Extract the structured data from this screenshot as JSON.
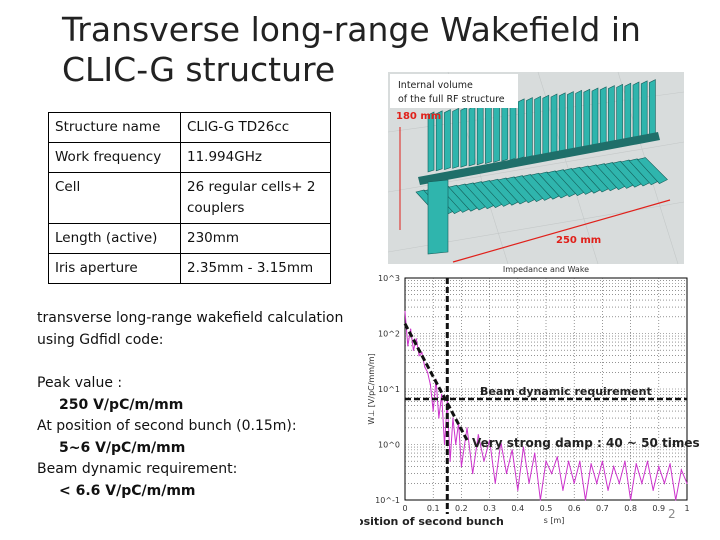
{
  "title": "Transverse long-range Wakefield in CLIC-G structure",
  "table": [
    {
      "key": "Structure name",
      "value": "CLIG-G TD26cc"
    },
    {
      "key": "Work frequency",
      "value": "11.994GHz"
    },
    {
      "key": "Cell",
      "value": "26 regular cells+ 2 couplers"
    },
    {
      "key": "Length (active)",
      "value": "230mm"
    },
    {
      "key": "Iris aperture",
      "value": "2.35mm - 3.15mm"
    }
  ],
  "description": "transverse long-range wakefield calculation using Gdfidl code:",
  "notes": [
    {
      "label": "Peak value :",
      "value": "250 V/pC/m/mm"
    },
    {
      "label": "At position of second bunch (0.15m):",
      "value": "5~6 V/pC/m/mm"
    },
    {
      "label": "Beam dynamic requirement:",
      "value": "< 6.6 V/pC/m/mm"
    }
  ],
  "render": {
    "caption_line1": "Internal volume",
    "caption_line2": "of the full RF structure",
    "height_label": "180 mm",
    "length_label": "250 mm",
    "structure_color": "#2fb5ad",
    "dim_color": "#e0201a"
  },
  "page_number": "2",
  "chart_data": {
    "type": "line",
    "title": "Impedance and Wake",
    "xlabel": "s [m]",
    "ylabel": "W⊥ [V/pC/mm/m]",
    "xlim": [
      0,
      1
    ],
    "ylim": [
      0.1,
      1000
    ],
    "yscale": "log",
    "grid": true,
    "xticks": [
      "0",
      "0.1",
      "0.2",
      "0.3",
      "0.4",
      "0.5",
      "0.6",
      "0.7",
      "0.8",
      "0.9",
      "1"
    ],
    "yticks": [
      "10^-1",
      "10^0",
      "10^1",
      "10^2",
      "10^3"
    ],
    "series": [
      {
        "color": "#cc33cc",
        "x": [
          0,
          0.01,
          0.02,
          0.03,
          0.04,
          0.05,
          0.06,
          0.07,
          0.08,
          0.09,
          0.1,
          0.11,
          0.12,
          0.13,
          0.14,
          0.15,
          0.16,
          0.17,
          0.18,
          0.19,
          0.2,
          0.22,
          0.24,
          0.26,
          0.28,
          0.3,
          0.32,
          0.34,
          0.36,
          0.38,
          0.4,
          0.42,
          0.44,
          0.46,
          0.48,
          0.5,
          0.52,
          0.54,
          0.56,
          0.58,
          0.6,
          0.62,
          0.64,
          0.66,
          0.68,
          0.7,
          0.72,
          0.74,
          0.76,
          0.78,
          0.8,
          0.82,
          0.84,
          0.86,
          0.88,
          0.9,
          0.92,
          0.94,
          0.96,
          0.98,
          1.0
        ],
        "y": [
          250,
          60,
          120,
          50,
          80,
          40,
          45,
          25,
          20,
          12,
          4,
          15,
          3,
          8,
          1,
          6,
          0.5,
          3,
          1,
          2.5,
          0.4,
          2,
          0.3,
          1.5,
          0.5,
          1.2,
          0.2,
          1.1,
          0.3,
          0.8,
          0.15,
          0.9,
          0.2,
          0.7,
          0.1,
          0.5,
          0.3,
          0.6,
          0.15,
          0.5,
          0.2,
          0.5,
          0.1,
          0.45,
          0.2,
          0.5,
          0.15,
          0.4,
          0.2,
          0.5,
          0.1,
          0.45,
          0.2,
          0.5,
          0.15,
          0.4,
          0.2,
          0.45,
          0.1,
          0.35,
          0.2
        ]
      }
    ],
    "annotations": {
      "requirement": {
        "label": "Beam dynamic requirement",
        "value": 6.6
      },
      "second_bunch": {
        "label": "Position of second bunch",
        "s": 0.15
      },
      "damping": {
        "label": "Very strong damp : 40 ~ 50 times",
        "from": [
          0,
          150
        ],
        "to": [
          0.22,
          1.2
        ]
      }
    }
  }
}
